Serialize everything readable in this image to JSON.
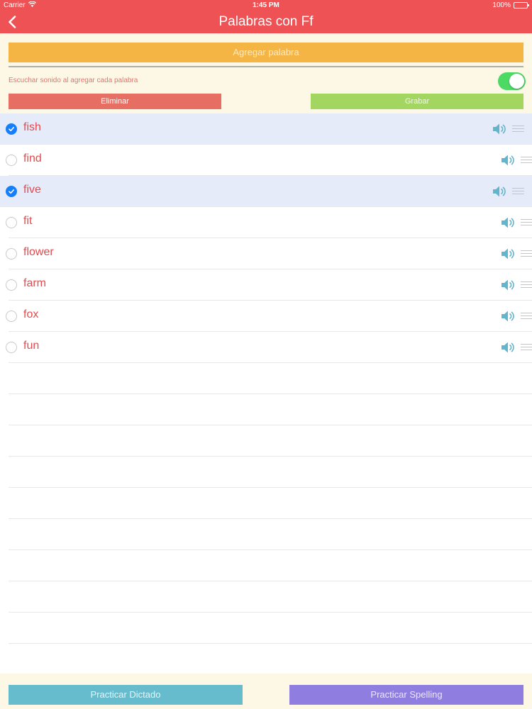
{
  "status_bar": {
    "carrier": "Carrier",
    "time": "1:45 PM",
    "battery": "100%",
    "wifi_icon": "wifi-icon",
    "battery_icon": "battery-icon"
  },
  "nav": {
    "title": "Palabras con Ff",
    "back_icon": "chevron-left-icon"
  },
  "controls": {
    "add_word_label": "Agregar palabra",
    "sound_toggle_label": "Escuchar sonido al agregar cada palabra",
    "sound_toggle_on": true,
    "delete_label": "Eliminar",
    "record_label": "Grabar"
  },
  "words": [
    {
      "text": "fish",
      "selected": true
    },
    {
      "text": "find",
      "selected": false
    },
    {
      "text": "five",
      "selected": true
    },
    {
      "text": "fit",
      "selected": false
    },
    {
      "text": "flower",
      "selected": false
    },
    {
      "text": "farm",
      "selected": false
    },
    {
      "text": "fox",
      "selected": false
    },
    {
      "text": "fun",
      "selected": false
    }
  ],
  "bottom": {
    "dictation_label": "Practicar Dictado",
    "spelling_label": "Practicar Spelling"
  },
  "colors": {
    "header": "#ef5255",
    "add_button": "#f4b545",
    "delete_button": "#e76e62",
    "record_button": "#a2d660",
    "dictation_button": "#66bccc",
    "spelling_button": "#8f7ddf",
    "word_text": "#e44a4d",
    "selected_row": "#e6ebf9",
    "checkmark": "#157efb",
    "speaker_icon": "#63b5cb",
    "toggle_on": "#4cd964"
  }
}
